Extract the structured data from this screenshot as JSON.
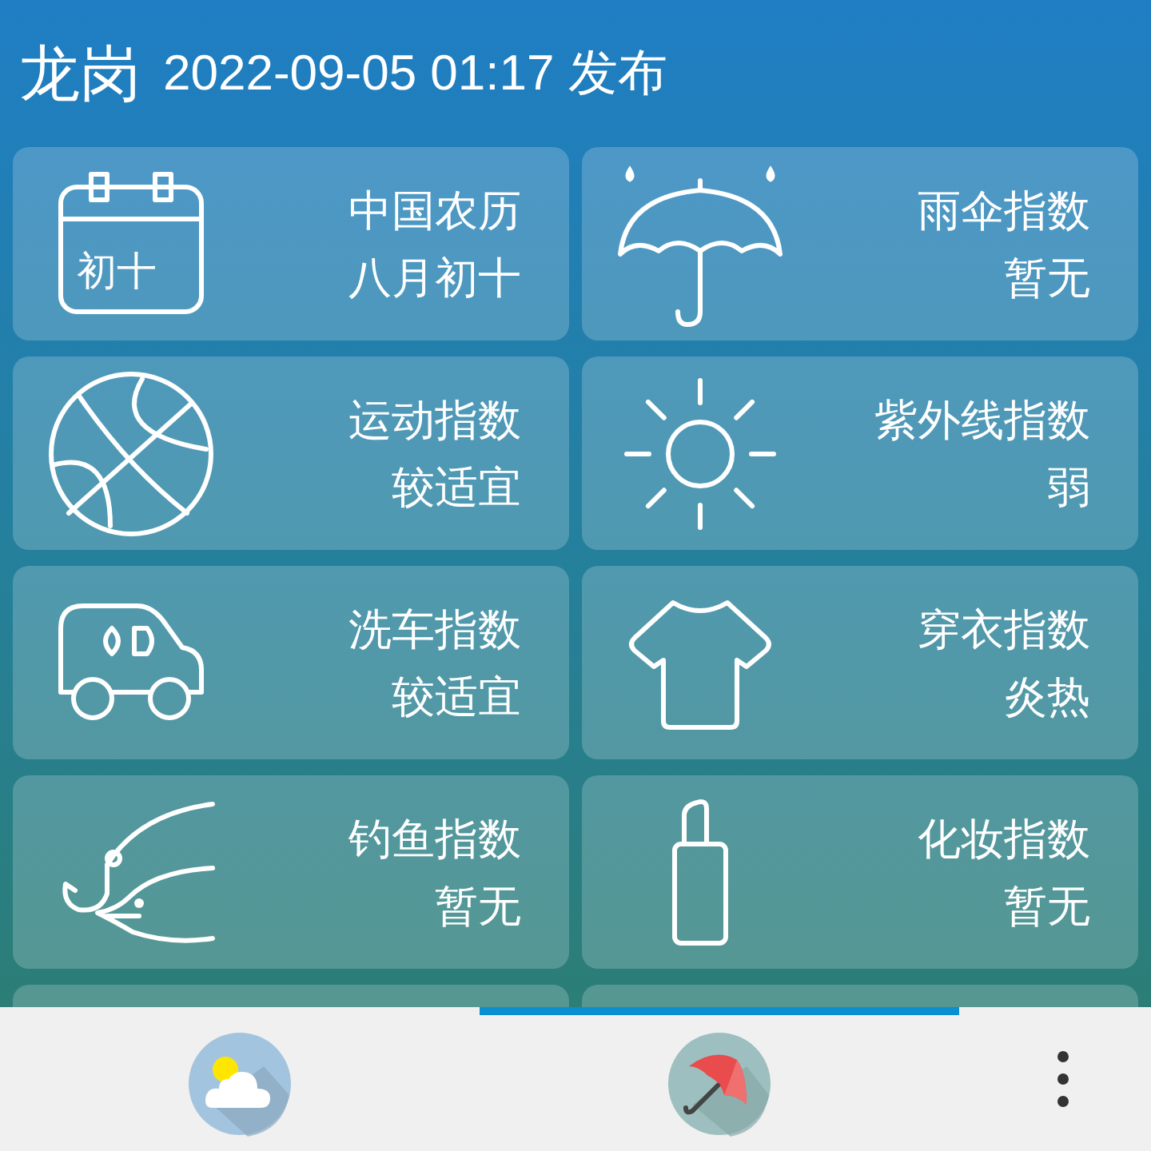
{
  "header": {
    "city": "龙岗",
    "time": "2022-09-05 01:17 发布"
  },
  "cards": [
    {
      "kind": "calendar",
      "icon_text": "初十",
      "title": "中国农历",
      "value": "八月初十"
    },
    {
      "kind": "umbrella",
      "title": "雨伞指数",
      "value": "暂无"
    },
    {
      "kind": "ball",
      "title": "运动指数",
      "value": "较适宜"
    },
    {
      "kind": "sun",
      "title": "紫外线指数",
      "value": "弱"
    },
    {
      "kind": "car",
      "title": "洗车指数",
      "value": "较适宜"
    },
    {
      "kind": "shirt",
      "title": "穿衣指数",
      "value": "炎热"
    },
    {
      "kind": "fishing",
      "title": "钓鱼指数",
      "value": "暂无"
    },
    {
      "kind": "lipstick",
      "title": "化妆指数",
      "value": "暂无"
    }
  ],
  "tabs": [
    {
      "kind": "weather",
      "selected": false
    },
    {
      "kind": "umbrella",
      "selected": true
    }
  ]
}
